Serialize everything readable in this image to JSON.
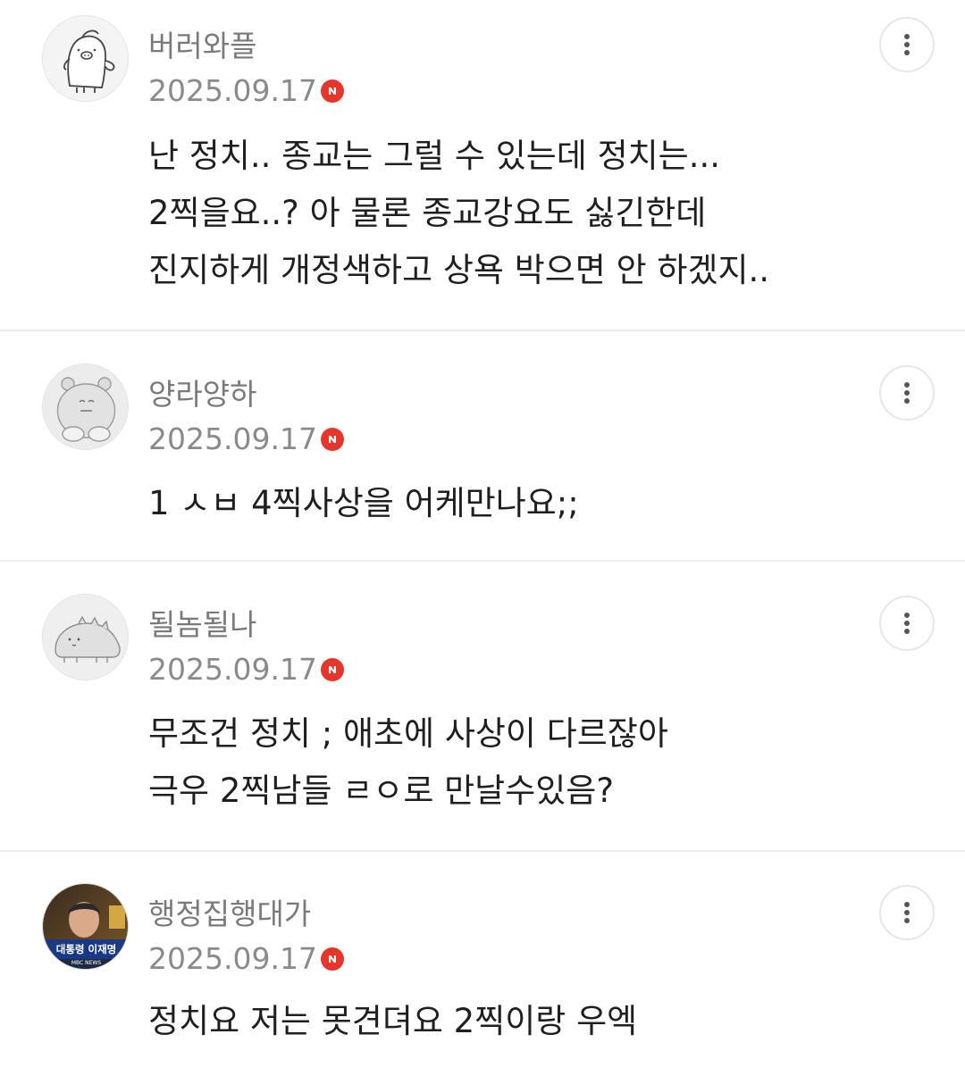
{
  "comments": [
    {
      "nickname": "버러와플",
      "date": "2025.09.17",
      "avatar_icon": "pig-character-icon",
      "lines": [
        "난 정치.. 종교는 그럴 수 있는데 정치는...",
        "2찍을요..? 아 물론 종교강요도 싫긴한데",
        "진지하게 개정색하고 상욕 박으면 안 하겠지.."
      ]
    },
    {
      "nickname": "양라양하",
      "date": "2025.09.17",
      "avatar_icon": "bear-character-icon",
      "lines": [
        "1 ㅅㅂ 4찍사상을 어케만나요;;"
      ]
    },
    {
      "nickname": "될놈될나",
      "date": "2025.09.17",
      "avatar_icon": "dinosaur-character-icon",
      "lines": [
        "무조건 정치 ; 애초에 사상이 다르잖아",
        "극우 2찍남들 ㄹㅇ로 만날수있음?"
      ]
    },
    {
      "nickname": "행정집행대가",
      "date": "2025.09.17",
      "avatar_icon": "profile-photo",
      "avatar_caption": "대통령 이재명",
      "avatar_small_text": "MBC NEWS",
      "lines": [
        "정치요 저는 못견뎌요 2찍이랑 우엑"
      ]
    }
  ],
  "badge_icon": "naver-n-badge-icon",
  "more_icon": "more-vertical-icon",
  "colors": {
    "badge": "#e5362c",
    "nickname": "#7a7a7a",
    "date": "#8a8a8a",
    "divider": "#ececec"
  }
}
